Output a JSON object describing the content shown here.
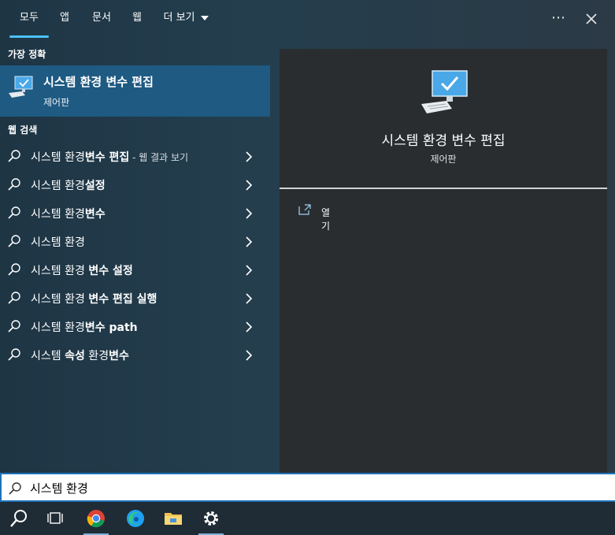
{
  "tabs": [
    {
      "label": "모두",
      "active": true
    },
    {
      "label": "앱",
      "active": false
    },
    {
      "label": "문서",
      "active": false
    },
    {
      "label": "웹",
      "active": false
    },
    {
      "label": "더 보기",
      "active": false
    }
  ],
  "top_icons": {
    "more": "⋯",
    "close": "✕"
  },
  "best_match": {
    "heading": "가장 정확",
    "title": "시스템 환경 변수 편집",
    "subtitle": "제어판"
  },
  "web_search": {
    "heading": "웹 검색",
    "items": [
      {
        "plain": "시스템 환경",
        "bold": "변수 편집",
        "rest": "",
        "hint": " - 웹 결과 보기"
      },
      {
        "plain": "시스템 환경",
        "bold": "설정",
        "rest": "",
        "hint": ""
      },
      {
        "plain": "시스템 환경",
        "bold": "변수",
        "rest": "",
        "hint": ""
      },
      {
        "plain": "시스템 환경",
        "bold": "",
        "rest": "",
        "hint": ""
      },
      {
        "plain": "시스템 환경 ",
        "bold": "변수 설정",
        "rest": "",
        "hint": ""
      },
      {
        "plain": "시스템 환경 ",
        "bold": "변수 편집 실행",
        "rest": "",
        "hint": ""
      },
      {
        "plain": "시스템 환경",
        "bold": "변수 path",
        "rest": "",
        "hint": ""
      },
      {
        "plain": "시스템 ",
        "bold": "속성",
        "rest": " 환경",
        "bold2": "변수",
        "hint": ""
      }
    ]
  },
  "detail": {
    "title": "시스템 환경 변수 편집",
    "subtitle": "제어판",
    "actions": [
      {
        "label": "열기",
        "icon": "open-external-icon"
      }
    ]
  },
  "search": {
    "value": "시스템 환경",
    "placeholder": ""
  },
  "taskbar": {
    "items": [
      "search-icon",
      "task-view-icon",
      "chrome-icon",
      "edge-icon",
      "file-explorer-icon",
      "settings-icon"
    ]
  },
  "colors": {
    "accent": "#4cc2ff",
    "selection": "#1e5a82",
    "detail_bg": "#2a2d30",
    "taskbar_bg": "#1f2b35"
  }
}
